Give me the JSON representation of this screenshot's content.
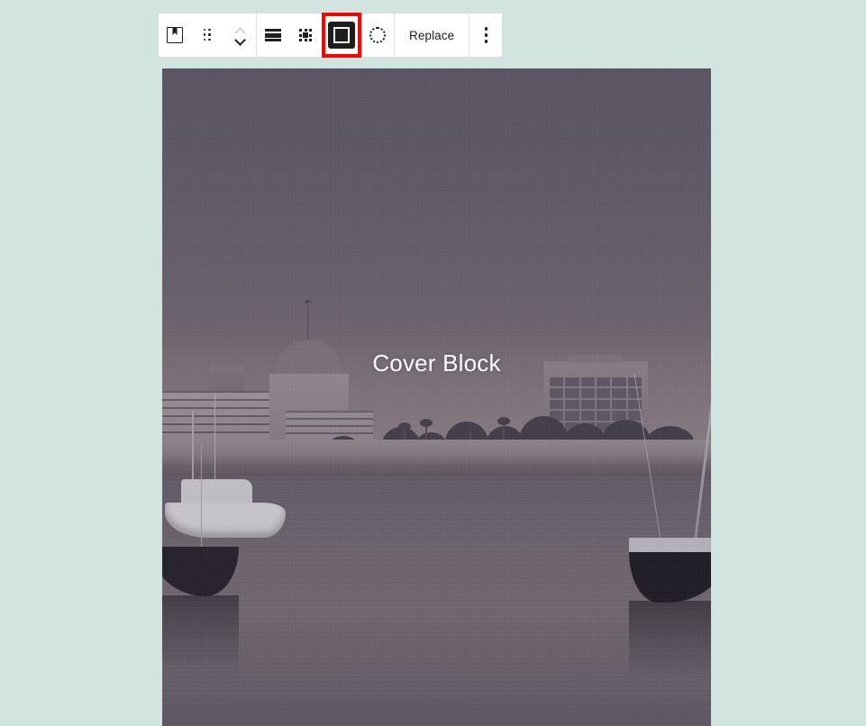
{
  "page": {
    "background_color": "#d2e4df"
  },
  "toolbar": {
    "name": "block-toolbar",
    "groups": [
      {
        "name": "block-type-and-move",
        "buttons": [
          {
            "name": "cover-block-icon-button",
            "icon": "cover-block-icon",
            "label": ""
          },
          {
            "name": "drag-handle-button",
            "icon": "drag-handle-icon",
            "label": ""
          },
          {
            "name": "move-up-down-button",
            "icon": "chevron-up-down-icon",
            "label": ""
          }
        ]
      },
      {
        "name": "block-formatting",
        "buttons": [
          {
            "name": "align-button",
            "icon": "align-icon",
            "label": ""
          },
          {
            "name": "content-position-button",
            "icon": "position-grid-icon",
            "label": ""
          },
          {
            "name": "full-height-toggle-button",
            "icon": "fullscreen-icon",
            "label": "",
            "selected": true,
            "highlighted": true
          },
          {
            "name": "duotone-filter-button",
            "icon": "dotted-circle-icon",
            "label": ""
          }
        ]
      },
      {
        "name": "media-actions",
        "buttons": [
          {
            "name": "replace-button",
            "icon": "",
            "label": "Replace"
          }
        ]
      },
      {
        "name": "more-options",
        "buttons": [
          {
            "name": "options-button",
            "icon": "vertical-ellipsis-icon",
            "label": ""
          }
        ]
      }
    ],
    "highlight_color": "#ff0000",
    "background_color": "#ffffff",
    "border_color": "#dcdcdc"
  },
  "cover_block": {
    "name": "cover-block",
    "title": "Cover Block",
    "title_color": "#ffffff",
    "image_description": "marina harbor at dusk with moored sailboats, waterfront condominiums, a domed building and a multi-storey hotel",
    "overlay_color": "#2d2834"
  }
}
